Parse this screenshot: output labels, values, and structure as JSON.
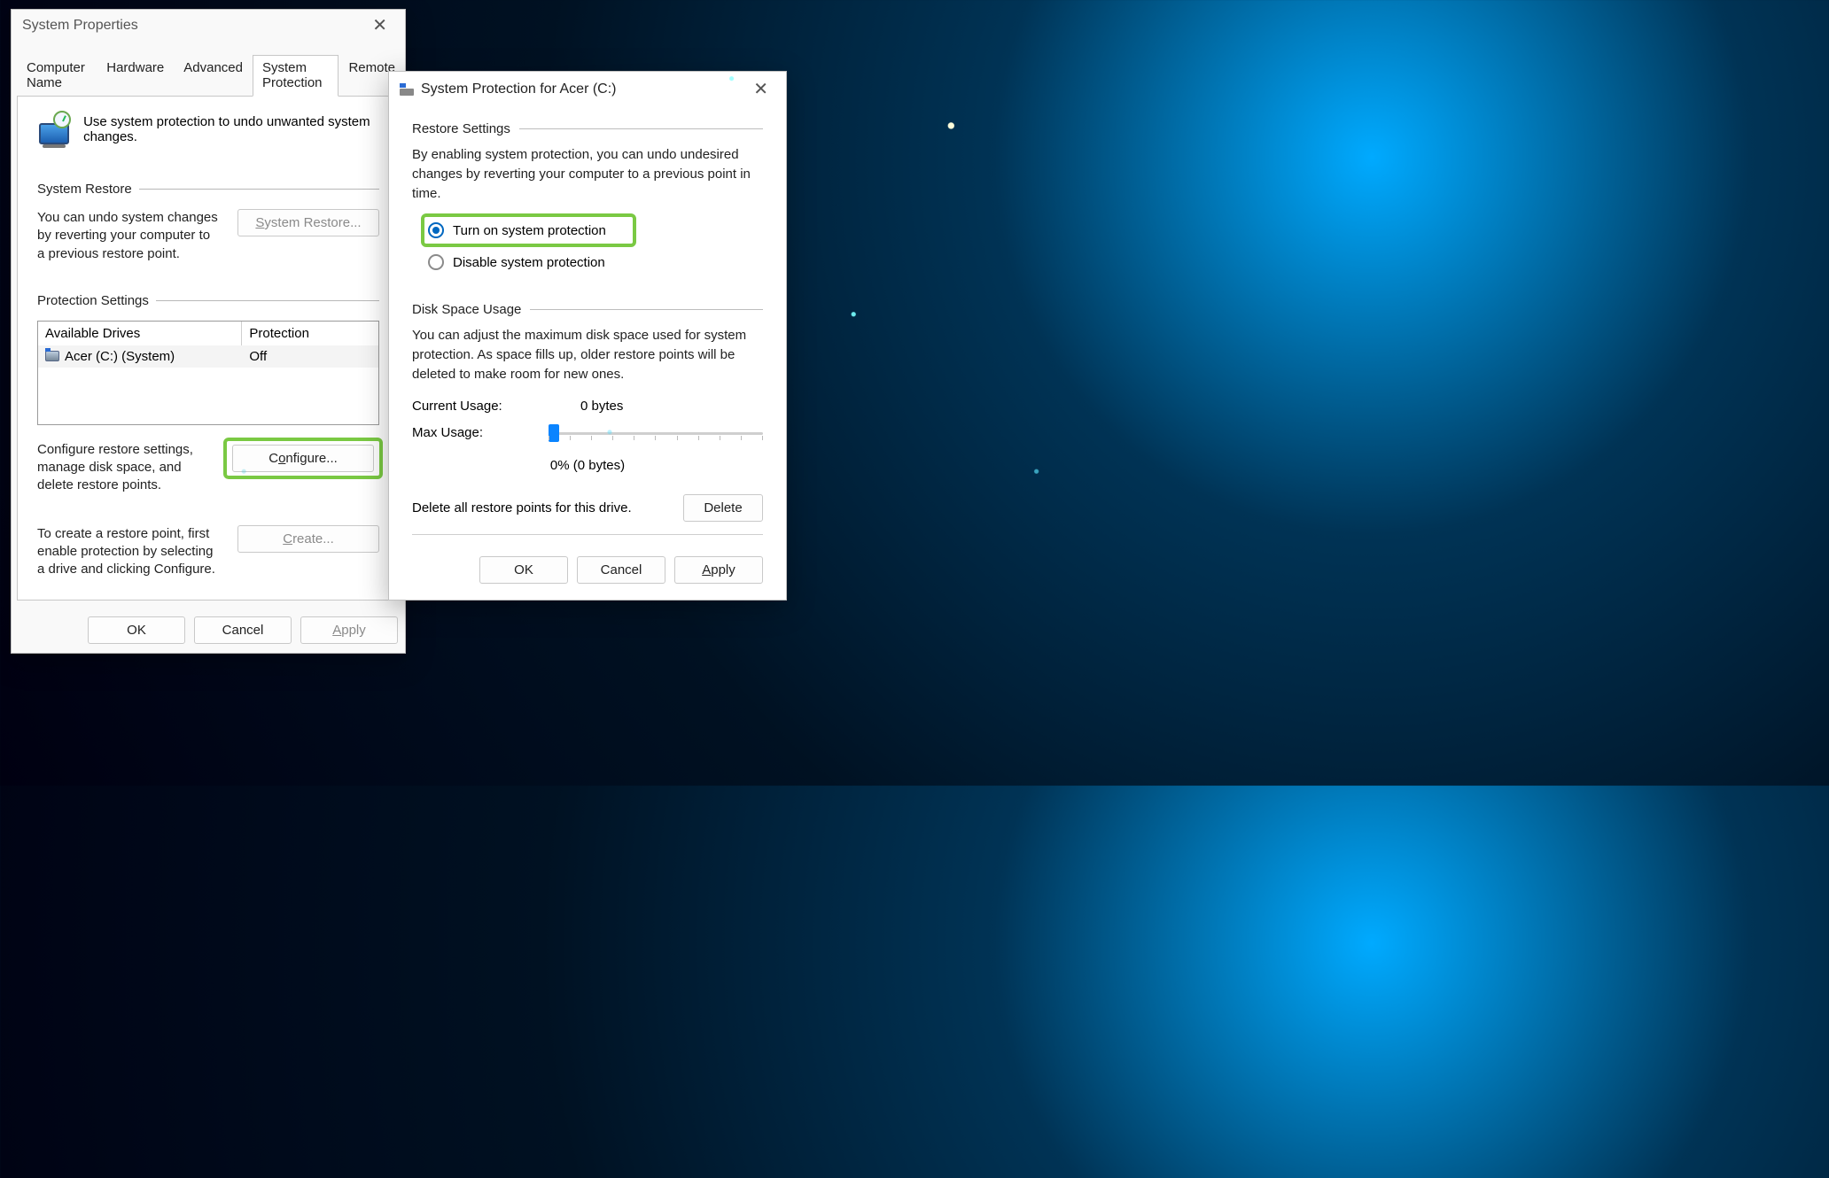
{
  "sysprops": {
    "title": "System Properties",
    "tabs": [
      "Computer Name",
      "Hardware",
      "Advanced",
      "System Protection",
      "Remote"
    ],
    "activeTab": "System Protection",
    "intro": "Use system protection to undo unwanted system changes.",
    "restore": {
      "heading": "System Restore",
      "desc": "You can undo system changes by reverting your computer to a previous restore point.",
      "button": "System Restore..."
    },
    "protection": {
      "heading": "Protection Settings",
      "col_drives": "Available Drives",
      "col_protection": "Protection",
      "drive_name": "Acer (C:) (System)",
      "drive_status": "Off",
      "configure_desc": "Configure restore settings, manage disk space, and delete restore points.",
      "configure_btn": "Configure...",
      "create_desc": "To create a restore point, first enable protection by selecting a drive and clicking Configure.",
      "create_btn": "Create..."
    },
    "footer": {
      "ok": "OK",
      "cancel": "Cancel",
      "apply": "Apply"
    }
  },
  "spdlg": {
    "title": "System Protection for Acer (C:)",
    "restore": {
      "heading": "Restore Settings",
      "desc": "By enabling system protection, you can undo undesired changes by reverting your computer to a previous point in time.",
      "opt_on": "Turn on system protection",
      "opt_off": "Disable system protection"
    },
    "disk": {
      "heading": "Disk Space Usage",
      "desc": "You can adjust the maximum disk space used for system protection. As space fills up, older restore points will be deleted to make room for new ones.",
      "current_label": "Current Usage:",
      "current_value": "0 bytes",
      "max_label": "Max Usage:",
      "max_value": "0% (0 bytes)",
      "delete_desc": "Delete all restore points for this drive.",
      "delete_btn": "Delete"
    },
    "footer": {
      "ok": "OK",
      "cancel": "Cancel",
      "apply": "Apply"
    }
  }
}
